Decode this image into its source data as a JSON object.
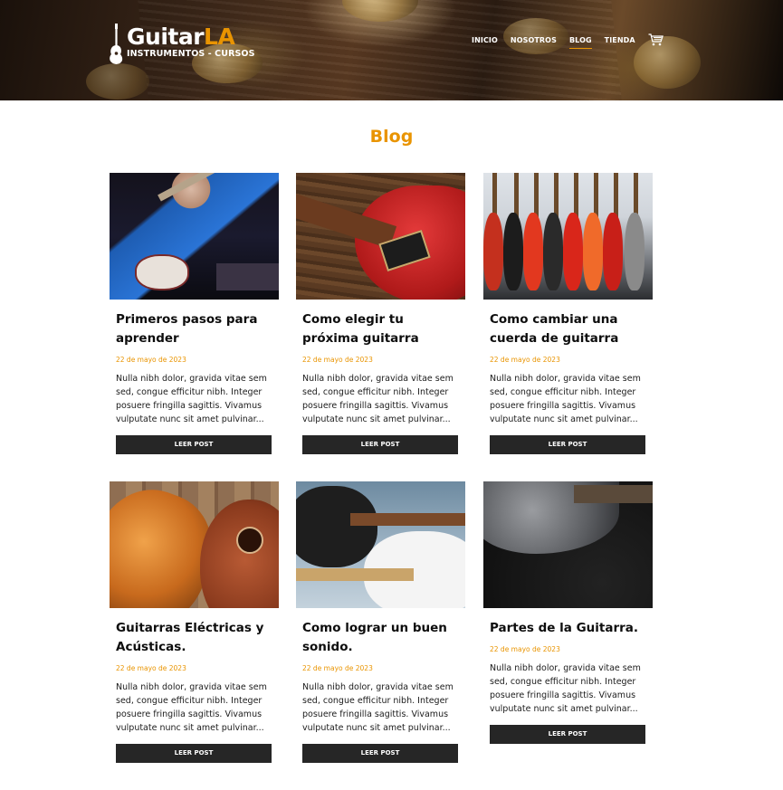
{
  "header": {
    "logo": {
      "brand_main": "Guitar",
      "brand_accent": "LA",
      "tagline": "INSTRUMENTOS - CURSOS"
    },
    "nav": [
      {
        "label": "INICIO",
        "active": false
      },
      {
        "label": "NOSOTROS",
        "active": false
      },
      {
        "label": "BLOG",
        "active": true
      },
      {
        "label": "TIENDA",
        "active": false
      }
    ],
    "cart_icon": "cart-icon"
  },
  "page": {
    "title": "Blog"
  },
  "colors": {
    "accent": "#e99401",
    "button_bg": "#262626",
    "text": "#0d0d0d"
  },
  "posts": [
    {
      "title": "Primeros pasos para aprender",
      "date": "22 de mayo de 2023",
      "excerpt": "Nulla nibh dolor, gravida vitae sem sed, congue efficitur nibh. Integer posuere fringilla sagittis. Vivamus vulputate nunc sit amet pulvinar...",
      "button": "LEER POST"
    },
    {
      "title": "Como elegir tu próxima guitarra",
      "date": "22 de mayo de 2023",
      "excerpt": "Nulla nibh dolor, gravida vitae sem sed, congue efficitur nibh. Integer posuere fringilla sagittis. Vivamus vulputate nunc sit amet pulvinar...",
      "button": "LEER POST"
    },
    {
      "title": "Como cambiar una cuerda de guitarra",
      "date": "22 de mayo de 2023",
      "excerpt": "Nulla nibh dolor, gravida vitae sem sed, congue efficitur nibh. Integer posuere fringilla sagittis. Vivamus vulputate nunc sit amet pulvinar...",
      "button": "LEER POST"
    },
    {
      "title": "Guitarras Eléctricas y Acústicas.",
      "date": "22 de mayo de 2023",
      "excerpt": "Nulla nibh dolor, gravida vitae sem sed, congue efficitur nibh. Integer posuere fringilla sagittis. Vivamus vulputate nunc sit amet pulvinar...",
      "button": "LEER POST"
    },
    {
      "title": "Como lograr un buen sonido.",
      "date": "22 de mayo de 2023",
      "excerpt": "Nulla nibh dolor, gravida vitae sem sed, congue efficitur nibh. Integer posuere fringilla sagittis. Vivamus vulputate nunc sit amet pulvinar...",
      "button": "LEER POST"
    },
    {
      "title": "Partes de la Guitarra.",
      "date": "22 de mayo de 2023",
      "excerpt": "Nulla nibh dolor, gravida vitae sem sed, congue efficitur nibh. Integer posuere fringilla sagittis. Vivamus vulputate nunc sit amet pulvinar...",
      "button": "LEER POST"
    }
  ]
}
